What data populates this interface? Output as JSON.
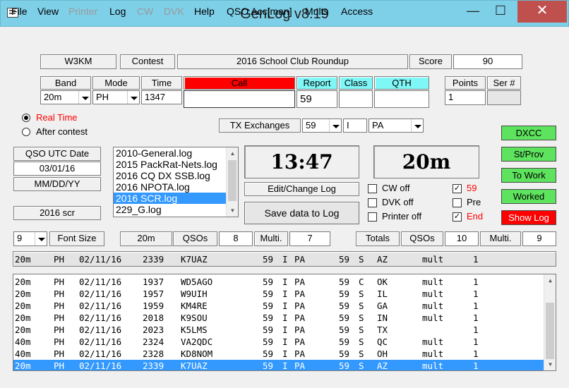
{
  "window": {
    "title": "GenLog     v8.19",
    "minimize_glyph": "—",
    "maximize_glyph": "☐",
    "close_glyph": "✕"
  },
  "menu": [
    "File",
    "View",
    "Printer",
    "Log",
    "CW",
    "DVK",
    "Help",
    "QSO Acc[man]",
    "Mults",
    "Access"
  ],
  "menu_disabled": [
    "Printer",
    "CW",
    "DVK"
  ],
  "header": {
    "callsign": "W3KM",
    "contest_label": "Contest",
    "contest_name": "2016 School Club Roundup",
    "score_label": "Score",
    "score_value": "90"
  },
  "entry": {
    "band_label": "Band",
    "mode_label": "Mode",
    "time_label": "Time",
    "call_label": "Call",
    "report_label": "Report",
    "class_label": "Class",
    "qth_label": "QTH",
    "points_label": "Points",
    "ser_label": "Ser #",
    "band_value": "20m",
    "mode_value": "PH",
    "time_value": "1347",
    "call_value": "",
    "report_value": "59",
    "class_value": "",
    "qth_value": "",
    "points_value": "1",
    "ser_value": ""
  },
  "time_mode": {
    "real_time": "Real Time",
    "after_contest": "After contest",
    "selected": "real_time"
  },
  "tx_exchanges": {
    "label": "TX Exchanges",
    "report": "59",
    "class": "I",
    "qth": "PA"
  },
  "date_panel": {
    "label": "QSO UTC Date",
    "date": "03/01/16",
    "format": "MM/DD/YY",
    "log_name": "2016 scr"
  },
  "log_files": [
    "2010-General.log",
    "2015 PackRat-Nets.log",
    "2016 CQ DX SSB.log",
    "2016 NPOTA.log",
    "2016 SCR.log",
    "229_G.log"
  ],
  "log_files_selected": 4,
  "clock": "13:47",
  "band_display": "20m",
  "edit_log_label": "Edit/Change Log",
  "save_label": "Save data to Log",
  "options": {
    "cw_off": "CW off",
    "dvk_off": "DVK off",
    "printer_off": "Printer off",
    "r59": "59",
    "pre": "Pre",
    "end": "End"
  },
  "right_buttons": [
    "DXCC",
    "St/Prov",
    "To Work",
    "Worked",
    "Show Log"
  ],
  "colors": {
    "call_bg": "#ff0000",
    "report_bg": "#7ff7f7",
    "green_btn": "#5ee35e",
    "show_log_bg": "#ff0000",
    "selection": "#3399ff",
    "titlebar": "#7ed0e8"
  },
  "stats": {
    "font_size_value": "9",
    "font_size_label": "Font Size",
    "band": "20m",
    "qsos_label": "QSOs",
    "band_qsos": "8",
    "mult_label": "Multi.",
    "band_mult": "7",
    "totals_label": "Totals",
    "total_qsos": "10",
    "total_mult": "9"
  },
  "last_qso": {
    "band": "20m",
    "mode": "PH",
    "date": "02/11/16",
    "time": "2339",
    "call": "K7UAZ",
    "rst_s": "59",
    "cls_s": "I",
    "qth_s": "PA",
    "rst_r": "59",
    "cls_r": "S",
    "qth_r": "AZ",
    "mult": "mult",
    "pts": "1"
  },
  "qsos": [
    {
      "band": "20m",
      "mode": "PH",
      "date": "02/11/16",
      "time": "1937",
      "call": "WD5AGO",
      "rst_s": "59",
      "cls_s": "I",
      "qth_s": "PA",
      "rst_r": "59",
      "cls_r": "C",
      "qth_r": "OK",
      "mult": "mult",
      "pts": "1"
    },
    {
      "band": "20m",
      "mode": "PH",
      "date": "02/11/16",
      "time": "1957",
      "call": "W9UIH",
      "rst_s": "59",
      "cls_s": "I",
      "qth_s": "PA",
      "rst_r": "59",
      "cls_r": "S",
      "qth_r": "IL",
      "mult": "mult",
      "pts": "1"
    },
    {
      "band": "20m",
      "mode": "PH",
      "date": "02/11/16",
      "time": "1959",
      "call": "KM4RE",
      "rst_s": "59",
      "cls_s": "I",
      "qth_s": "PA",
      "rst_r": "59",
      "cls_r": "S",
      "qth_r": "GA",
      "mult": "mult",
      "pts": "1"
    },
    {
      "band": "20m",
      "mode": "PH",
      "date": "02/11/16",
      "time": "2018",
      "call": "K9SOU",
      "rst_s": "59",
      "cls_s": "I",
      "qth_s": "PA",
      "rst_r": "59",
      "cls_r": "S",
      "qth_r": "IN",
      "mult": "mult",
      "pts": "1"
    },
    {
      "band": "20m",
      "mode": "PH",
      "date": "02/11/16",
      "time": "2023",
      "call": "K5LMS",
      "rst_s": "59",
      "cls_s": "I",
      "qth_s": "PA",
      "rst_r": "59",
      "cls_r": "S",
      "qth_r": "TX",
      "mult": "",
      "pts": "1"
    },
    {
      "band": "40m",
      "mode": "PH",
      "date": "02/11/16",
      "time": "2324",
      "call": "VA2QDC",
      "rst_s": "59",
      "cls_s": "I",
      "qth_s": "PA",
      "rst_r": "59",
      "cls_r": "S",
      "qth_r": "QC",
      "mult": "mult",
      "pts": "1"
    },
    {
      "band": "40m",
      "mode": "PH",
      "date": "02/11/16",
      "time": "2328",
      "call": "KD8NOM",
      "rst_s": "59",
      "cls_s": "I",
      "qth_s": "PA",
      "rst_r": "59",
      "cls_r": "S",
      "qth_r": "OH",
      "mult": "mult",
      "pts": "1"
    },
    {
      "band": "20m",
      "mode": "PH",
      "date": "02/11/16",
      "time": "2339",
      "call": "K7UAZ",
      "rst_s": "59",
      "cls_s": "I",
      "qth_s": "PA",
      "rst_r": "59",
      "cls_r": "S",
      "qth_r": "AZ",
      "mult": "mult",
      "pts": "1"
    }
  ],
  "qsos_selected": 7
}
